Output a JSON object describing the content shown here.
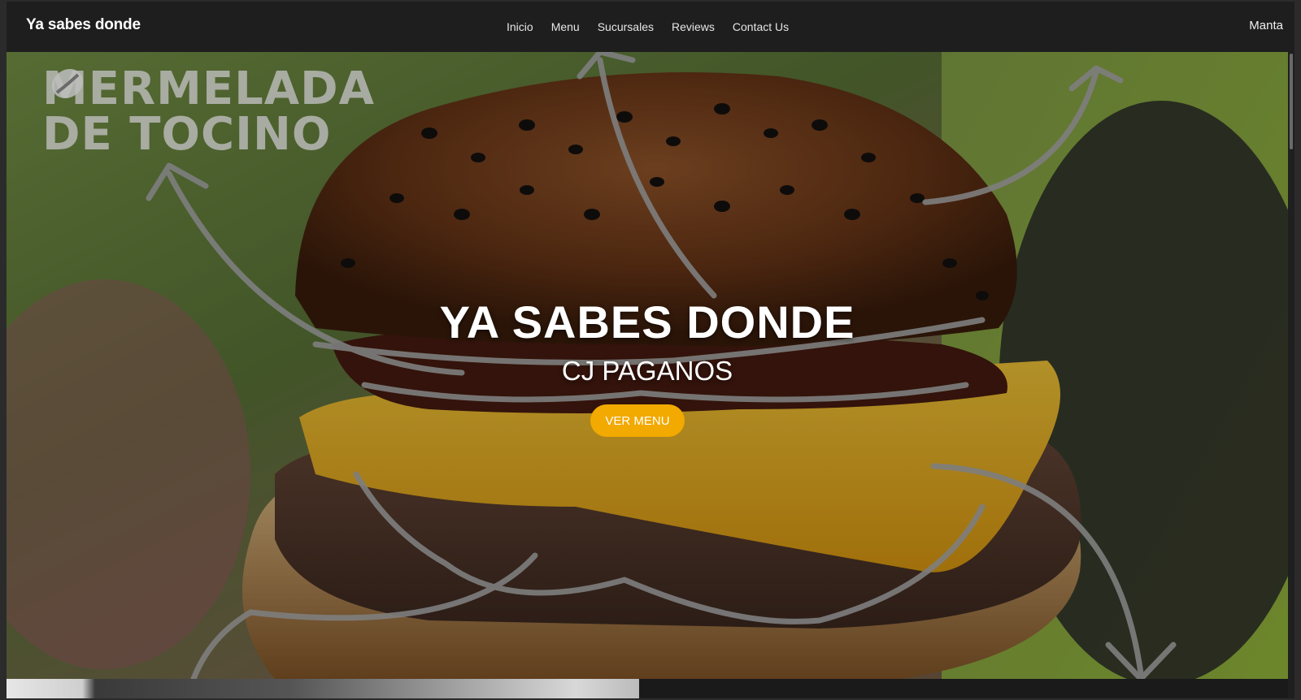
{
  "nav": {
    "brand": "Ya sabes donde",
    "links": [
      "Inicio",
      "Menu",
      "Sucursales",
      "Reviews",
      "Contact Us"
    ],
    "location": "Manta"
  },
  "hero": {
    "watermark_line1": "MERMELADA",
    "watermark_line2": "DE TOCINO",
    "title": "YA SABES DONDE",
    "subtitle": "CJ PAGANOS",
    "cta_label": "VER MENU"
  },
  "colors": {
    "navbar": "#1e1e1e",
    "accent": "#f2a900",
    "text": "#ffffff"
  }
}
